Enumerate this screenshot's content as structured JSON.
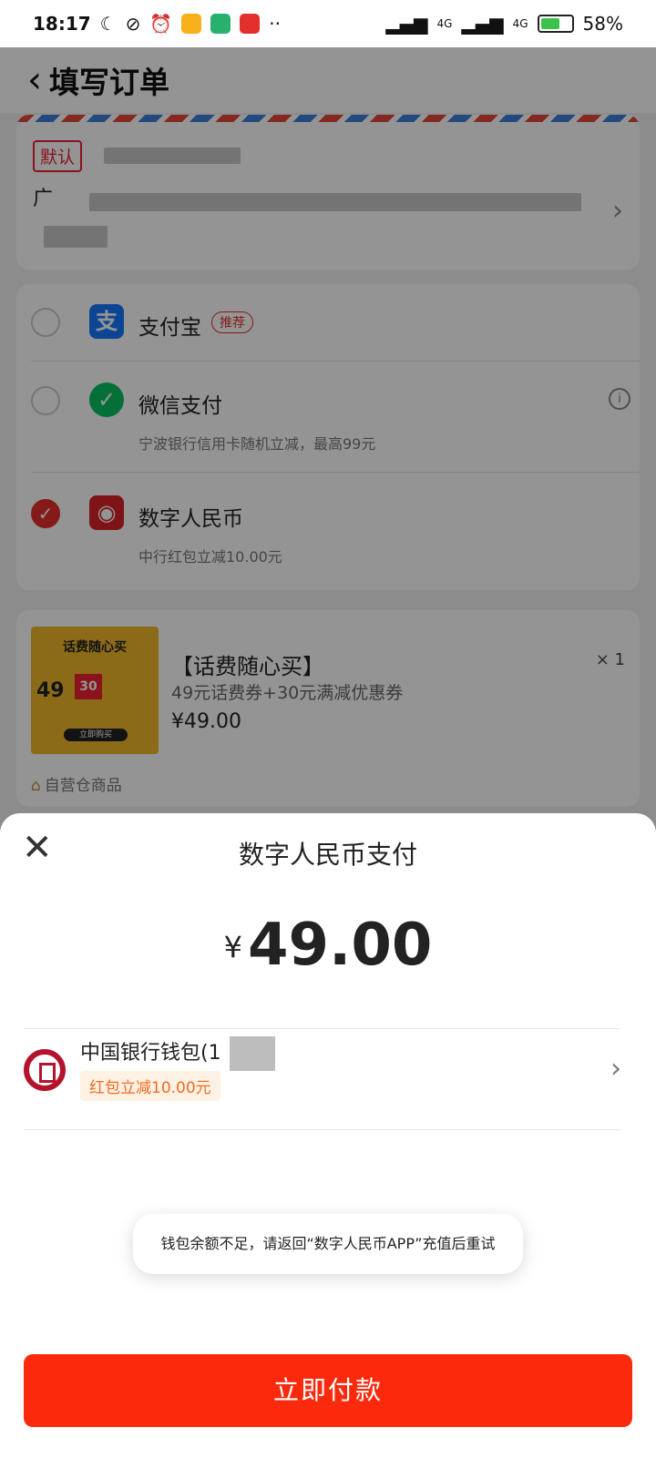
{
  "status_bar": {
    "time": "18:17",
    "network_1": "4G",
    "network_2": "4G",
    "battery": "58%",
    "battery_level": 0.58
  },
  "order_page": {
    "title": "填写订单",
    "address": {
      "default_tag": "默认",
      "first_char": "广"
    },
    "payment_methods": [
      {
        "name": "支付宝",
        "tag": "推荐",
        "selected": false,
        "logo": "alipay-icon",
        "color": "#1677ff"
      },
      {
        "name": "微信支付",
        "subtitle": "宁波银行信用卡随机立减，最高99元",
        "selected": false,
        "logo": "wechat-pay-icon",
        "color": "#07c160"
      },
      {
        "name": "数字人民币",
        "subtitle": "中行红包立减10.00元",
        "selected": true,
        "logo": "ecny-icon",
        "color": "#d9222a"
      }
    ],
    "product": {
      "image_title": "话费随心买",
      "image_amount": "49",
      "image_badge": "30",
      "image_button": "立即购买",
      "name": "【话费随心买】",
      "description": "49元话费券+30元满减优惠券",
      "price": "¥49.00",
      "quantity": "× 1",
      "store": "自营仓商品"
    }
  },
  "sheet": {
    "title": "数字人民币支付",
    "currency": "¥",
    "amount": "49.00",
    "wallet_name": "中国银行钱包(1",
    "promo": "红包立减10.00元",
    "toast": "钱包余额不足，请返回“数字人民币APP”充值后重试",
    "pay_button": "立即付款"
  }
}
